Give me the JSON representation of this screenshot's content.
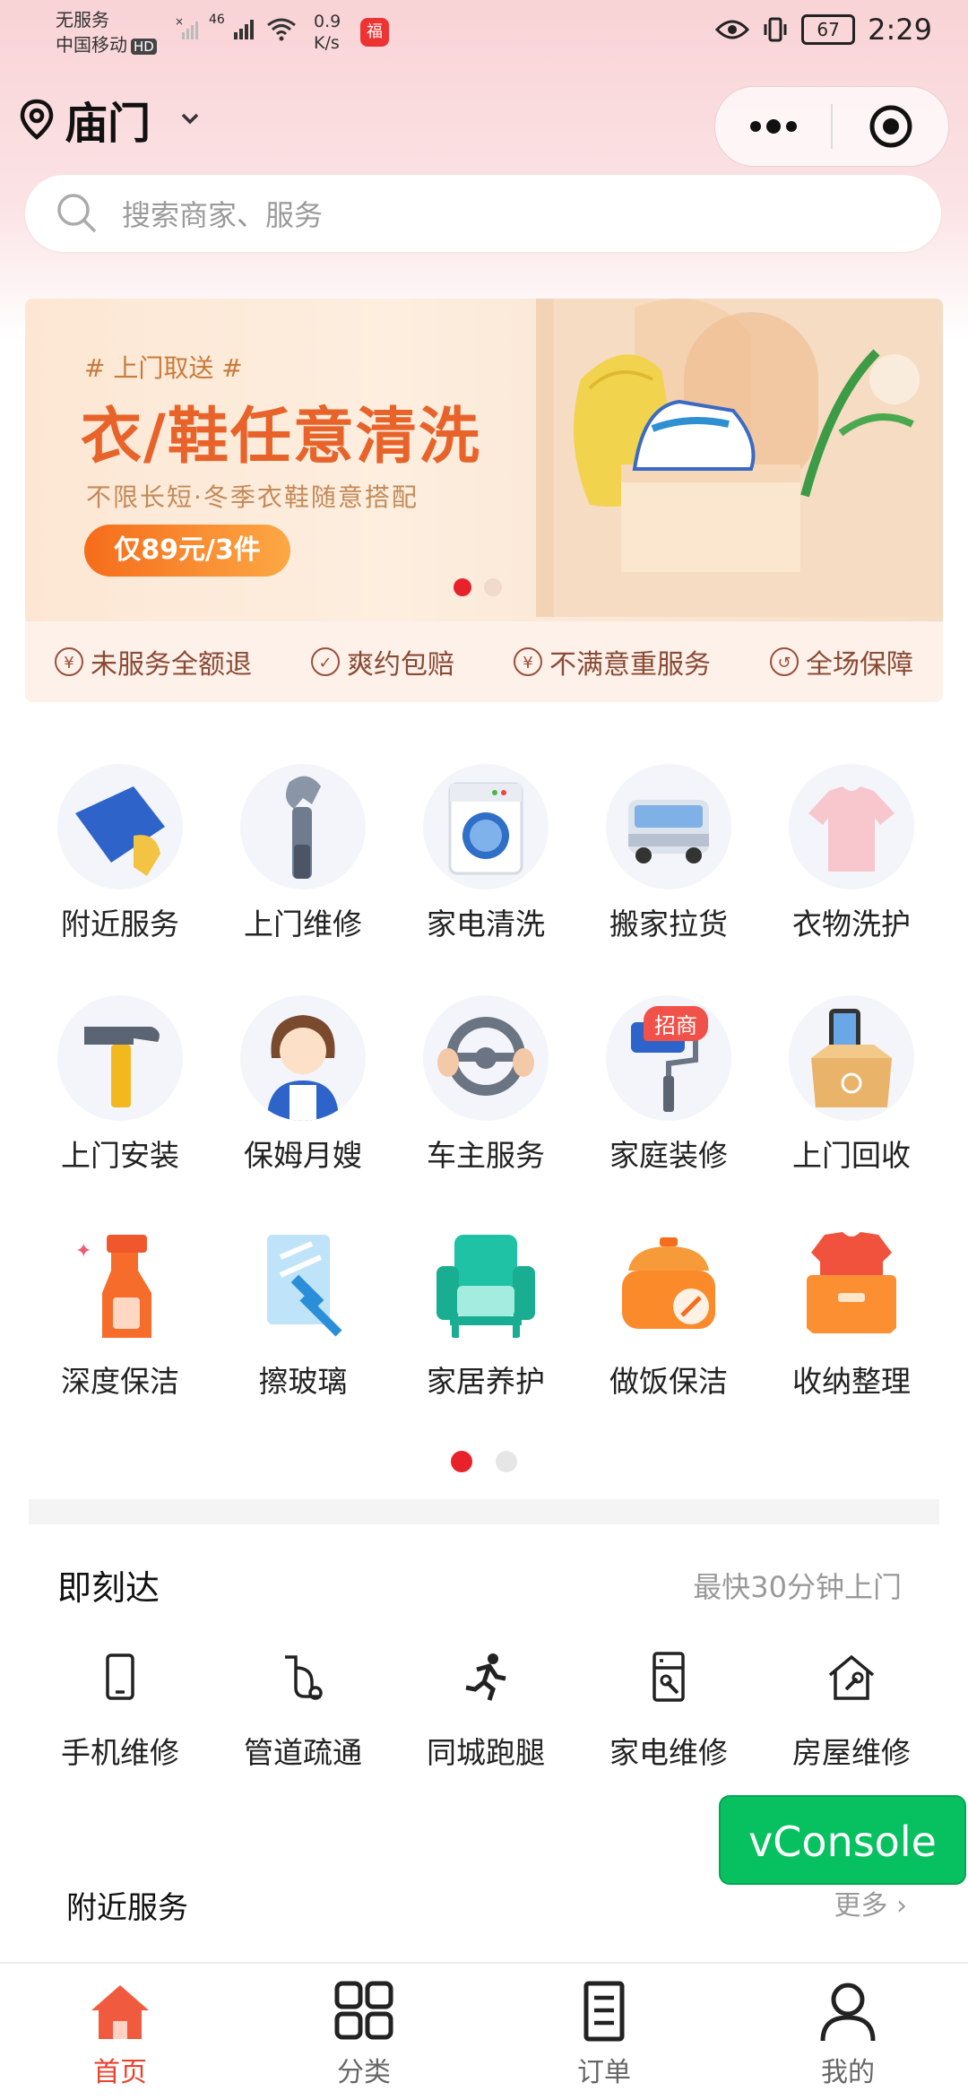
{
  "status_bar": {
    "no_service": "无服务",
    "carrier": "中国移动",
    "hd": "HD",
    "net_type": "46",
    "speed_value": "0.9",
    "speed_unit": "K/s",
    "battery": "67",
    "time": "2:29"
  },
  "header": {
    "location": "庙门"
  },
  "search": {
    "placeholder": "搜索商家、服务"
  },
  "banner": {
    "tag": "# 上门取送 #",
    "title": "衣/鞋任意清洗",
    "subtitle": "不限长短·冬季衣鞋随意搭配",
    "price": "仅89元/3件",
    "guarantees": [
      "未服务全额退",
      "爽约包赔",
      "不满意重服务",
      "全场保障"
    ]
  },
  "categories": [
    {
      "label": "附近服务",
      "icon": "cloth-hand-icon"
    },
    {
      "label": "上门维修",
      "icon": "wrench-icon"
    },
    {
      "label": "家电清洗",
      "icon": "washing-machine-icon"
    },
    {
      "label": "搬家拉货",
      "icon": "truck-icon"
    },
    {
      "label": "衣物洗护",
      "icon": "tshirt-icon"
    },
    {
      "label": "上门安装",
      "icon": "hammer-icon"
    },
    {
      "label": "保姆月嫂",
      "icon": "nanny-icon"
    },
    {
      "label": "车主服务",
      "icon": "steering-wheel-icon"
    },
    {
      "label": "家庭装修",
      "icon": "paint-roller-icon"
    },
    {
      "label": "上门回收",
      "icon": "recycle-box-icon"
    },
    {
      "label": "深度保洁",
      "icon": "spray-bottle-icon"
    },
    {
      "label": "擦玻璃",
      "icon": "squeegee-icon"
    },
    {
      "label": "家居养护",
      "icon": "armchair-icon"
    },
    {
      "label": "做饭保洁",
      "icon": "rice-cooker-icon"
    },
    {
      "label": "收纳整理",
      "icon": "storage-box-icon"
    }
  ],
  "badge_text": "招商",
  "instant": {
    "title": "即刻达",
    "subtitle": "最快30分钟上门",
    "items": [
      {
        "label": "手机维修",
        "icon": "phone-icon"
      },
      {
        "label": "管道疏通",
        "icon": "pipe-icon"
      },
      {
        "label": "同城跑腿",
        "icon": "runner-icon"
      },
      {
        "label": "家电维修",
        "icon": "appliance-icon"
      },
      {
        "label": "房屋维修",
        "icon": "house-repair-icon"
      }
    ]
  },
  "vconsole": "vConsole",
  "nearby": {
    "title": "附近服务",
    "more": "更多 ›"
  },
  "tabs": [
    {
      "label": "首页",
      "icon": "home-icon"
    },
    {
      "label": "分类",
      "icon": "grid-icon"
    },
    {
      "label": "订单",
      "icon": "order-icon"
    },
    {
      "label": "我的",
      "icon": "user-icon"
    }
  ],
  "colors": {
    "accent": "#e8222a",
    "tab_active": "#e8432e",
    "vconsole": "#07c160",
    "banner_title": "#e8632a"
  }
}
